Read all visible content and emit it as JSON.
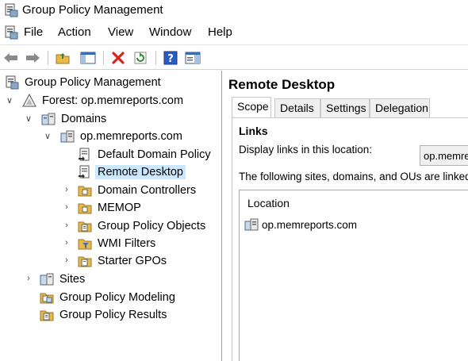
{
  "window": {
    "title": "Group Policy Management"
  },
  "menu": {
    "items": [
      "File",
      "Action",
      "View",
      "Window",
      "Help"
    ]
  },
  "tree": {
    "root": "Group Policy Management",
    "forest": "Forest: op.memreports.com",
    "domains": "Domains",
    "domain": "op.memreports.com",
    "default_policy": "Default Domain Policy",
    "remote_desktop": "Remote Desktop",
    "domain_controllers": "Domain Controllers",
    "memop": "MEMOP",
    "gpo": "Group Policy Objects",
    "wmi": "WMI Filters",
    "starter": "Starter GPOs",
    "sites": "Sites",
    "modeling": "Group Policy Modeling",
    "results": "Group Policy Results"
  },
  "details": {
    "title": "Remote Desktop",
    "tabs": [
      "Scope",
      "Details",
      "Settings",
      "Delegation"
    ],
    "links_label": "Links",
    "display_label": "Display links in this location:",
    "display_value": "op.memreports.com",
    "info": "The following sites, domains, and OUs are linked to this GPO:",
    "column_location": "Location",
    "row_location": "op.memreports.com"
  },
  "colors": {
    "selection": "#cce8ff",
    "folder": "#e8b84a",
    "close_red": "#d9261c",
    "help_blue": "#2a5bbf"
  }
}
